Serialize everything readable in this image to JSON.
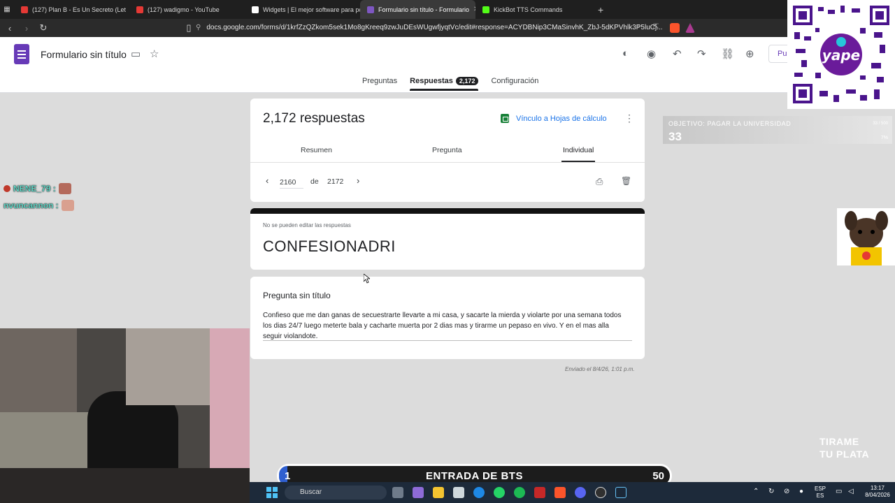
{
  "browser": {
    "tabs": [
      {
        "label": "(127) Plan B - Es Un Secreto (Let",
        "color": "#e53935",
        "active": false
      },
      {
        "label": "(127) wadigmo - YouTube",
        "color": "#e53935",
        "active": false
      },
      {
        "label": "Widgets | El mejor software para pot",
        "color": "#ffffff",
        "active": false
      },
      {
        "label": "Formulario sin título - Formulario",
        "color": "#7e57c2",
        "active": true
      },
      {
        "label": "KickBot TTS Commands",
        "color": "#53fc18",
        "active": false
      }
    ],
    "url": "docs.google.com/forms/d/1krfZzQZkom5sek1Mo8gKreeq9zwJuDEsWUgwfjyqtVc/edit#response=ACYDBNip3CMaSinvhK_ZbJ-5dKPVhlk3P5luCj..."
  },
  "form": {
    "title": "Formulario sin título",
    "publish_label": "Pul",
    "tabs": {
      "questions": "Preguntas",
      "responses": "Respuestas",
      "responses_count": "2,172",
      "settings": "Configuración"
    },
    "responses_heading": "2,172 respuestas",
    "sheets_link": "Vínculo a Hojas de cálculo",
    "subtabs": {
      "summary": "Resumen",
      "question": "Pregunta",
      "individual": "Individual"
    },
    "pager": {
      "current": "2160",
      "of": "de",
      "total": "2172"
    },
    "notice": "No se pueden editar las respuestas",
    "respondent": "CONFESIONADRI",
    "question_title": "Pregunta sin título",
    "answer": "Confieso que me dan ganas de secuestrarte llevarte a mi casa, y sacarte la mierda y violarte por una semana todos los dias 24/7 luego meterte bala y cacharte muerta por 2 dias mas y tirarme un pepaso en vivo. Y en el mas alla seguir violandote.",
    "sent": "Enviado el 8/4/26, 1:01 p.m."
  },
  "overlay": {
    "goal_label": "OBJETIVO: PAGAR LA UNIVERSIDAD",
    "goal_value": "33",
    "goal_percent": "7%",
    "goal_tiny": "33 / 500",
    "chat": [
      {
        "user": "NENE_79 :"
      },
      {
        "user": "nvuncannon :"
      }
    ],
    "qr_brand": "yape",
    "tirame": [
      "TIRAME",
      "TU PLATA"
    ],
    "bts": {
      "left": "1",
      "title": "ENTRADA DE BTS",
      "right": "50",
      "progress": 0.02
    }
  },
  "taskbar": {
    "search_placeholder": "Buscar",
    "lang": [
      "ESP",
      "ES"
    ],
    "time": "13:17",
    "date": "8/04/2026"
  },
  "colors": {
    "forms_purple": "#673ab7",
    "link_blue": "#1a73e8",
    "sheets_green": "#188038"
  }
}
